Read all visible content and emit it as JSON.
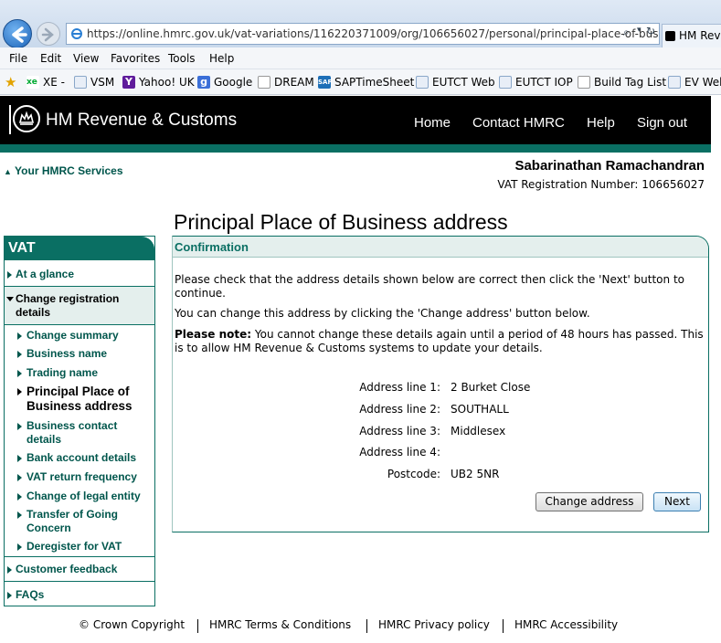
{
  "browser": {
    "url": "https://online.hmrc.gov.uk/vat-variations/116220371009/org/106656027/personal/principal-place-of-business/c",
    "tab_title": "HM Reve",
    "menu": [
      "File",
      "Edit",
      "View",
      "Favorites",
      "Tools",
      "Help"
    ],
    "favorites": [
      {
        "label": "XE -",
        "icon": "xe-icon"
      },
      {
        "label": "VSM",
        "icon": "ie-page-icon"
      },
      {
        "label": "Yahoo! UK",
        "icon": "yahoo-icon"
      },
      {
        "label": "Google",
        "icon": "google-icon"
      },
      {
        "label": "DREAM",
        "icon": "page-icon"
      },
      {
        "label": "SAPTimeSheet",
        "icon": "sap-icon"
      },
      {
        "label": "EUTCT Web",
        "icon": "ie-page-icon"
      },
      {
        "label": "EUTCT IOP",
        "icon": "ie-page-icon"
      },
      {
        "label": "Build Tag List",
        "icon": "page-icon"
      },
      {
        "label": "EV Web",
        "icon": "ie-page-icon"
      }
    ]
  },
  "header": {
    "title": "HM Revenue & Customs",
    "nav": [
      "Home",
      "Contact HMRC",
      "Help",
      "Sign out"
    ]
  },
  "account": {
    "services_link": "Your HMRC Services",
    "user_name": "Sabarinathan Ramachandran",
    "vat_reg": "VAT Registration Number: 106656027"
  },
  "page_title": "Principal Place of Business address",
  "sidebar": {
    "heading": "VAT",
    "at_a_glance": "At a glance",
    "change_registration": "Change registration details",
    "sub_items": [
      "Change summary",
      "Business name",
      "Trading name",
      "Principal Place of Business address",
      "Business contact details",
      "Bank account details",
      "VAT return frequency",
      "Change of legal entity",
      "Transfer of Going Concern",
      "Deregister for VAT"
    ],
    "customer_feedback": "Customer feedback",
    "faqs": "FAQs"
  },
  "panel": {
    "heading": "Confirmation",
    "para1": "Please check that the address details shown below are correct then click the 'Next' button to continue.",
    "para2": "You can change this address by clicking the 'Change address' button below.",
    "note_label": "Please note:",
    "note_text": " You cannot change these details again until a period of 48 hours has passed. This is to allow HM Revenue & Customs systems to update your details.",
    "address": [
      {
        "label": "Address line 1:",
        "value": "2 Burket Close"
      },
      {
        "label": "Address line 2:",
        "value": "SOUTHALL"
      },
      {
        "label": "Address line 3:",
        "value": "Middlesex"
      },
      {
        "label": "Address line 4:",
        "value": ""
      },
      {
        "label": "Postcode:",
        "value": "UB2 5NR"
      }
    ],
    "change_button": "Change address",
    "next_button": "Next"
  },
  "footer": [
    "© Crown Copyright",
    "HMRC Terms & Conditions",
    "HMRC Privacy policy",
    "HMRC Accessibility"
  ]
}
